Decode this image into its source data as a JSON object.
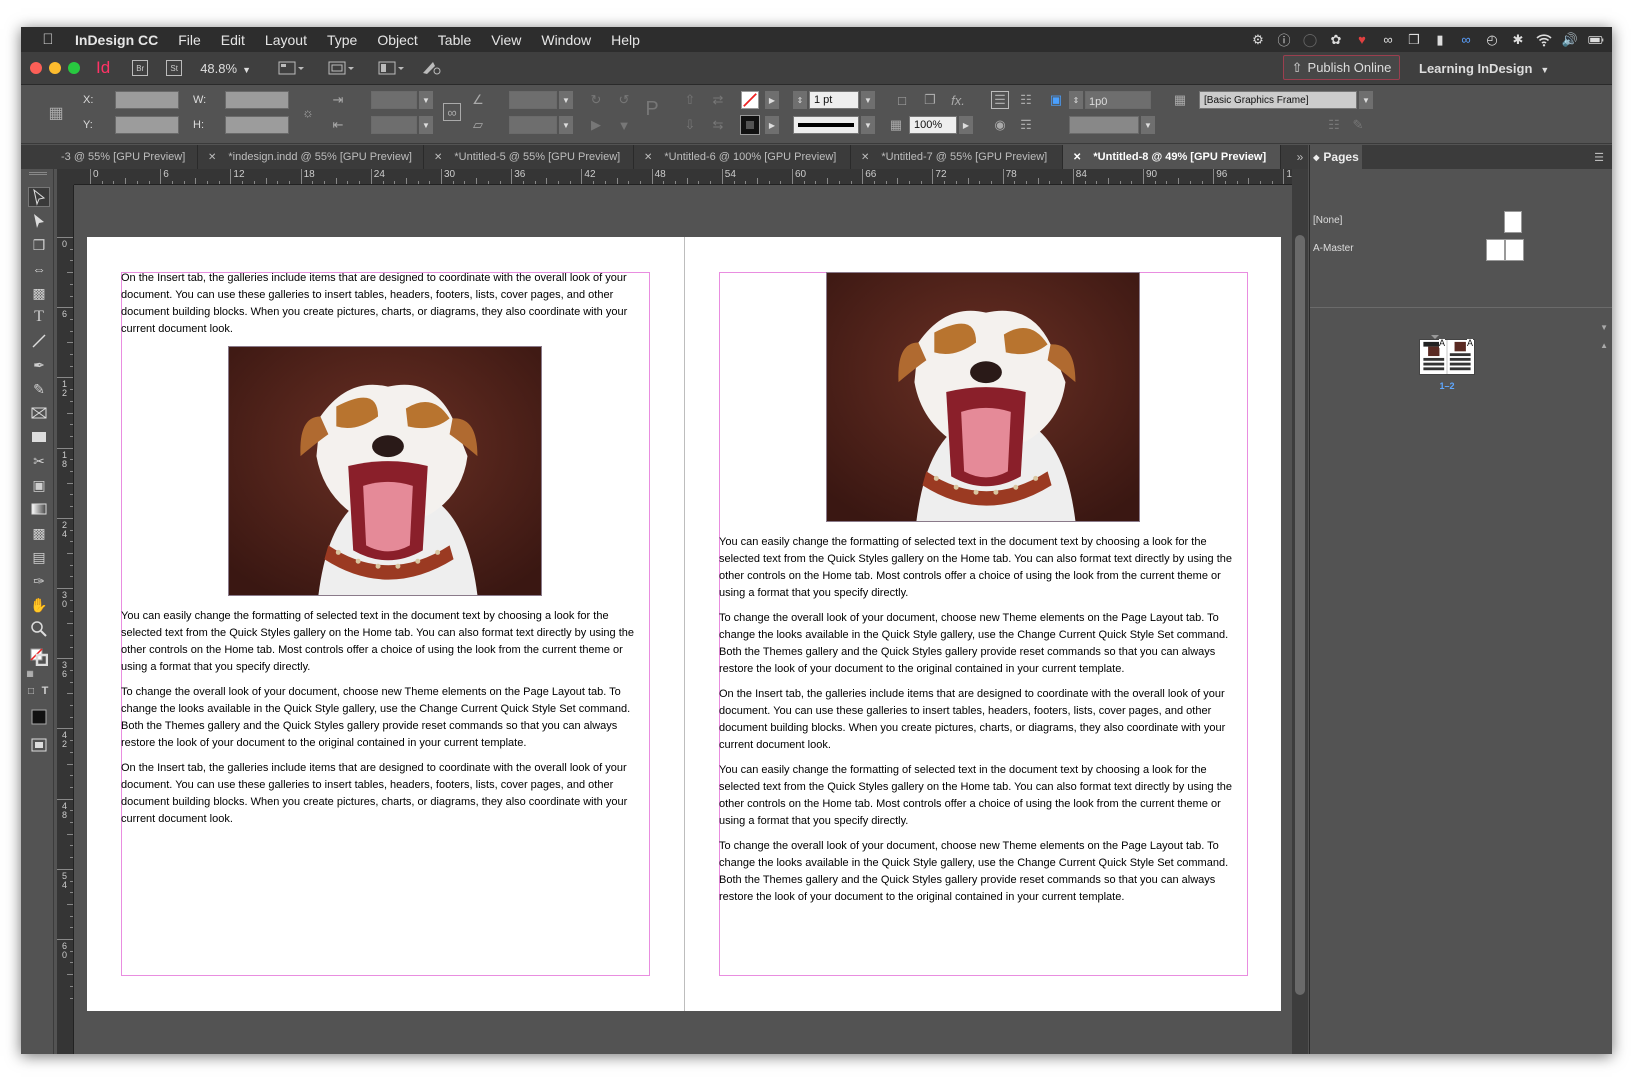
{
  "menubar": {
    "app_name": "InDesign CC",
    "items": [
      "File",
      "Edit",
      "Layout",
      "Type",
      "Object",
      "Table",
      "View",
      "Window",
      "Help"
    ]
  },
  "appbar": {
    "app_logo": "Id",
    "bridge": "Br",
    "stock": "St",
    "zoom": "48.8%",
    "publish_label": "Publish Online",
    "workspace_label": "Learning InDesign"
  },
  "control": {
    "x_label": "X:",
    "y_label": "Y:",
    "w_label": "W:",
    "h_label": "H:",
    "stroke_weight": "1 pt",
    "opacity": "100%",
    "gutter": "1p0",
    "object_style": "[Basic Graphics Frame]"
  },
  "tabs": [
    {
      "label": "-3 @ 55% [GPU Preview]",
      "active": false
    },
    {
      "label": "*indesign.indd @ 55% [GPU Preview]",
      "active": false
    },
    {
      "label": "*Untitled-5 @ 55% [GPU Preview]",
      "active": false
    },
    {
      "label": "*Untitled-6 @ 100% [GPU Preview]",
      "active": false
    },
    {
      "label": "*Untitled-7 @ 55% [GPU Preview]",
      "active": false
    },
    {
      "label": "*Untitled-8 @ 49% [GPU Preview]",
      "active": true
    }
  ],
  "ruler": {
    "h_ticks": [
      "0",
      "6",
      "12",
      "18",
      "24",
      "30",
      "36",
      "42",
      "48",
      "54",
      "60",
      "66",
      "72",
      "78",
      "84",
      "90",
      "96",
      "1("
    ],
    "v_ticks": [
      "0",
      "6",
      "1 2",
      "1 8",
      "2 4",
      "3 0",
      "3 6",
      "4 2",
      "4 8",
      "5 4",
      "6 0"
    ]
  },
  "pages_panel": {
    "title": "Pages",
    "masters": [
      "[None]",
      "A-Master"
    ],
    "spread_label": "1–2",
    "page_prefix": "A"
  },
  "document": {
    "left_top_para": "On the Insert tab, the galleries include items that are designed to coordinate with the overall look of your document. You can use these galleries to insert tables, headers, footers, lists, cover pages, and other document building blocks. When you create pictures, charts, or diagrams, they also coordinate with your current document look.",
    "left_paras": [
      "You can easily change the formatting of selected text in the document text by choosing a look for the selected text from the Quick Styles gallery on the Home tab. You can also format text directly by using the other controls on the Home tab. Most controls offer a choice of using the look from the current theme or using a format that you specify directly.",
      "To change the overall look of your document, choose new Theme elements on the Page Layout tab. To change the looks available in the Quick Style gallery, use the Change Current Quick Style Set command. Both the Themes gallery and the Quick Styles gallery provide reset commands so that you can always restore the look of your document to the original contained in your current template.",
      "On the Insert tab, the galleries include items that are designed to coordinate with the overall look of your document. You can use these galleries to insert tables, headers, footers, lists, cover pages, and other document building blocks. When you create pictures, charts, or diagrams, they also coordinate with your current document look."
    ],
    "right_paras": [
      "You can easily change the formatting of selected text in the document text by choosing a look for the selected text from the Quick Styles gallery on the Home tab. You can also format text directly by using the other controls on the Home tab. Most controls offer a choice of using the look from the current theme or using a format that you specify directly.",
      "To change the overall look of your document, choose new Theme elements on the Page Layout tab. To change the looks available in the Quick Style gallery, use the Change Current Quick Style Set command. Both the Themes gallery and the Quick Styles gallery provide reset commands so that you can always restore the look of your document to the original contained in your current template.",
      "On the Insert tab, the galleries include items that are designed to coordinate with the overall look of your document. You can use these galleries to insert tables, headers, footers, lists, cover pages, and other document building blocks. When you create pictures, charts, or diagrams, they also coordinate with your current document look.",
      "You can easily change the formatting of selected text in the document text by choosing a look for the selected text from the Quick Styles gallery on the Home tab. You can also format text directly by using the other controls on the Home tab. Most controls offer a choice of using the look from the current theme or using a format that you specify directly.",
      "To change the overall look of your document, choose new Theme elements on the Page Layout tab. To change the looks available in the Quick Style gallery, use the Change Current Quick Style Set command. Both the Themes gallery and the Quick Styles gallery provide reset commands so that you can always restore the look of your document to the original contained in your current template."
    ]
  },
  "colors": {
    "app_accent": "#ff3366",
    "frame_edge": "#e98de0",
    "image_bg": "#4a211a"
  }
}
